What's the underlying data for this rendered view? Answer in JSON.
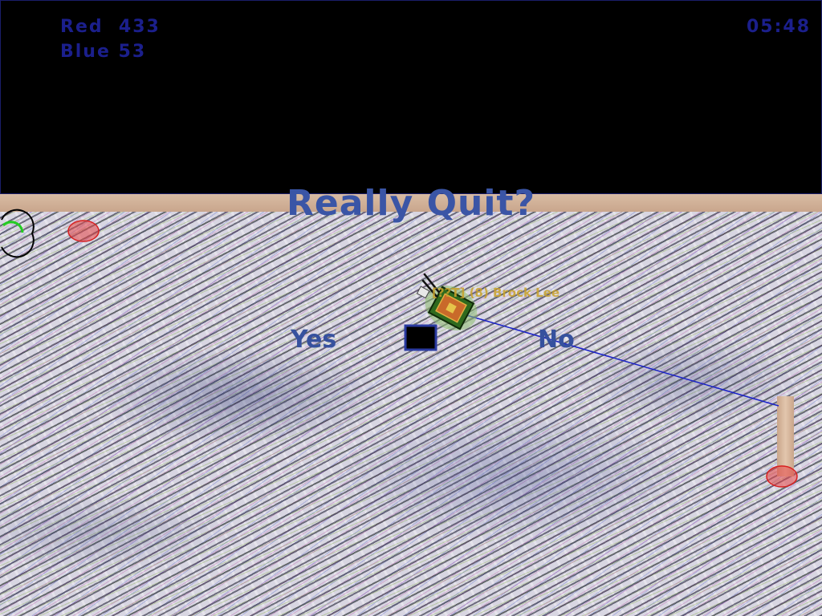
{
  "hud": {
    "red_score": "Red  433",
    "blue_score": "Blue 53",
    "timer": "05:48"
  },
  "dialog": {
    "title": "Really Quit?",
    "yes_label": "Yes",
    "no_label": "No"
  },
  "player": {
    "label": "[??T] (8) Brock Lee"
  },
  "colors": {
    "hud_text": "#1b1f8c",
    "dialog_text": "#3a55a6",
    "player_label": "#c9a22a",
    "wall": "#d2b39c",
    "aim_line": "#1a22c8",
    "flag_marker": "#d82020",
    "radar_arc": "#22cc22"
  },
  "icons": {
    "tank": "tank-icon",
    "flag_marker_left": "red-flag-marker-icon",
    "flag_marker_right": "red-flag-marker-icon",
    "radar": "radar-indicator-icon",
    "cursor": "black-square-cursor-icon"
  }
}
